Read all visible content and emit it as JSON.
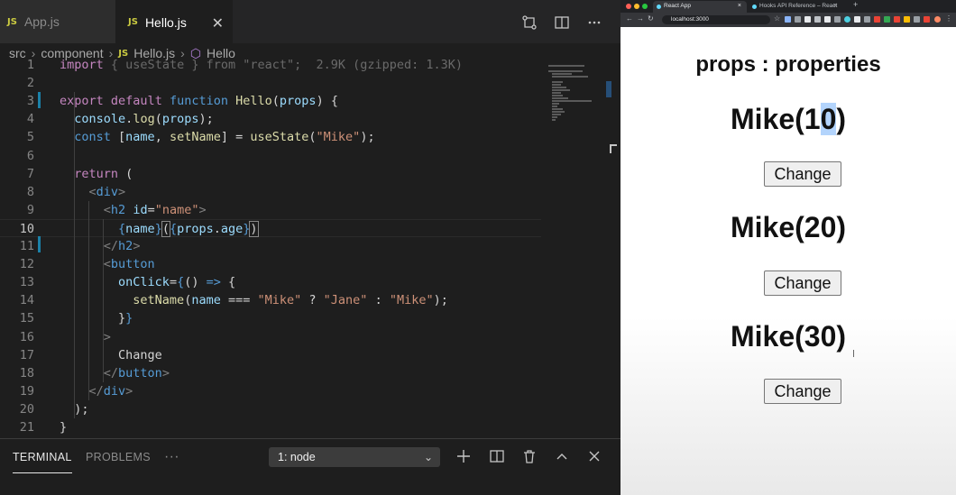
{
  "editor": {
    "tabs": [
      {
        "badge": "JS",
        "label": "App.js"
      },
      {
        "badge": "JS",
        "label": "Hello.js",
        "close": "✕"
      }
    ],
    "breadcrumb": {
      "parts": [
        "src",
        "component"
      ],
      "file_badge": "JS",
      "file": "Hello.js",
      "symbol": "Hello"
    },
    "lines": [
      {
        "n": "1",
        "html": "<span class=\"kw\">import</span> <span class=\"dim\">{ useState } from \"react\";  2.9K (gzipped: 1.3K)</span>"
      },
      {
        "n": "2",
        "html": ""
      },
      {
        "n": "3",
        "html": "<span class=\"kw\">export</span> <span class=\"kw\">default</span> <span class=\"kw2\">function</span> <span class=\"fn\">Hello</span>(<span class=\"var\">props</span>) {"
      },
      {
        "n": "4",
        "html": "  <span class=\"var\">console</span>.<span class=\"fn\">log</span>(<span class=\"var\">props</span>);"
      },
      {
        "n": "5",
        "html": "  <span class=\"kw2\">const</span> [<span class=\"var\">name</span>, <span class=\"fn\">setName</span>] = <span class=\"fn\">useState</span>(<span class=\"str\">\"Mike\"</span>);"
      },
      {
        "n": "6",
        "html": ""
      },
      {
        "n": "7",
        "html": "  <span class=\"kw\">return</span> ("
      },
      {
        "n": "8",
        "html": "    <span class=\"pun\">&lt;</span><span class=\"tag\">div</span><span class=\"pun\">&gt;</span>"
      },
      {
        "n": "9",
        "html": "      <span class=\"pun\">&lt;</span><span class=\"tag\">h2</span> <span class=\"var\">id</span>=<span class=\"str\">\"name\"</span><span class=\"pun\">&gt;</span>"
      },
      {
        "n": "10",
        "html": "        <span class=\"kw2\">{</span><span class=\"var\">name</span><span class=\"kw2\">}</span><span class=\"bracket-box\">(</span><span class=\"kw2\">{</span><span class=\"var\">props</span>.<span class=\"var\">age</span><span class=\"kw2\">}</span><span class=\"bracket-box\">)</span>"
      },
      {
        "n": "11",
        "html": "      <span class=\"pun\">&lt;/</span><span class=\"tag\">h2</span><span class=\"pun\">&gt;</span>"
      },
      {
        "n": "12",
        "html": "      <span class=\"pun\">&lt;</span><span class=\"tag\">button</span>"
      },
      {
        "n": "13",
        "html": "        <span class=\"var\">onClick</span>=<span class=\"kw2\">{</span>() <span class=\"kw2\">=&gt;</span> {"
      },
      {
        "n": "14",
        "html": "          <span class=\"fn\">setName</span>(<span class=\"var\">name</span> === <span class=\"str\">\"Mike\"</span> ? <span class=\"str\">\"Jane\"</span> : <span class=\"str\">\"Mike\"</span>);"
      },
      {
        "n": "15",
        "html": "        }<span class=\"kw2\">}</span>"
      },
      {
        "n": "16",
        "html": "      <span class=\"pun\">&gt;</span>"
      },
      {
        "n": "17",
        "html": "        Change"
      },
      {
        "n": "18",
        "html": "      <span class=\"pun\">&lt;/</span><span class=\"tag\">button</span><span class=\"pun\">&gt;</span>"
      },
      {
        "n": "19",
        "html": "    <span class=\"pun\">&lt;/</span><span class=\"tag\">div</span><span class=\"pun\">&gt;</span>"
      },
      {
        "n": "20",
        "html": "  );"
      },
      {
        "n": "21",
        "html": "}"
      }
    ],
    "active_line": "10"
  },
  "panel": {
    "tabs": [
      "TERMINAL",
      "PROBLEMS"
    ],
    "more": "···",
    "terminal_select": "1: node"
  },
  "browser": {
    "tabs": [
      {
        "label": "React App",
        "close": "×"
      },
      {
        "label": "Hooks API Reference – React",
        "close": "×"
      }
    ],
    "url": "localhost:3000",
    "page": {
      "title": "props : properties",
      "items": [
        {
          "name": "Mike",
          "age": "10",
          "button": "Change"
        },
        {
          "name": "Mike",
          "age": "20",
          "button": "Change"
        },
        {
          "name": "Mike",
          "age": "30",
          "button": "Change"
        }
      ]
    }
  },
  "colors": {
    "editor_bg": "#1e1e1e",
    "accent": "#1b81a8",
    "selection": "#b3d4fc"
  }
}
